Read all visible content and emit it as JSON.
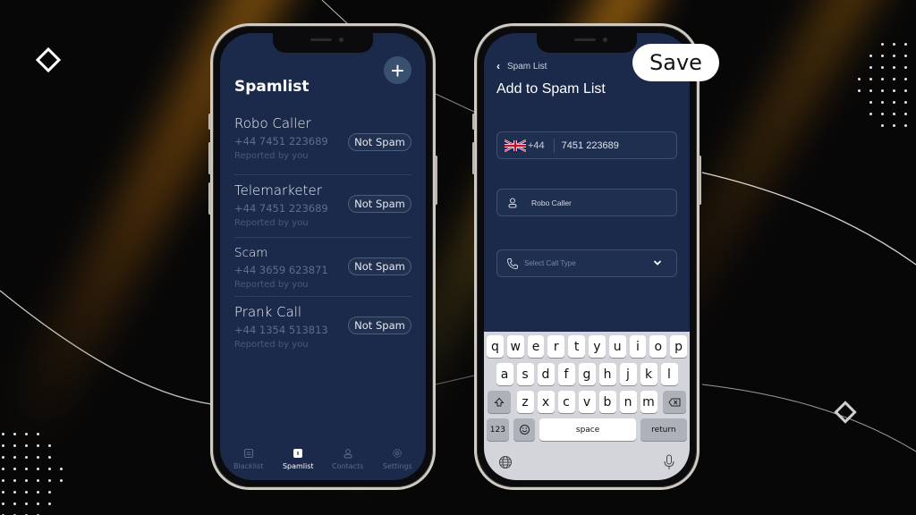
{
  "phone_left": {
    "title": "Spamlist",
    "add_button": "+",
    "items": [
      {
        "name": "Robo Caller",
        "number": "+44 7451 223689",
        "note": "Reported by you",
        "action": "Not Spam"
      },
      {
        "name": "Telemarketer",
        "number": "+44 7451 223689",
        "note": "Reported by you",
        "action": "Not Spam"
      },
      {
        "name": "Scam",
        "number": "+44 3659 623871",
        "note": "Reported by you",
        "action": "Not Spam"
      },
      {
        "name": "Prank Call",
        "number": "+44 1354 513813",
        "note": "Reported by you",
        "action": "Not Spam"
      }
    ],
    "tabs": [
      {
        "label": "Blacklist",
        "icon": "blacklist-icon",
        "active": false
      },
      {
        "label": "Spamlist",
        "icon": "spamlist-icon",
        "active": true
      },
      {
        "label": "Contacts",
        "icon": "contacts-icon",
        "active": false
      },
      {
        "label": "Settings",
        "icon": "settings-icon",
        "active": false
      }
    ]
  },
  "phone_right": {
    "back_label": "Spam List",
    "back_icon": "‹",
    "title": "Add to Spam List",
    "save_label": "Save",
    "phone_field": {
      "country_code": "+44",
      "value": "7451 223689",
      "flag": "uk-flag-icon"
    },
    "name_field": {
      "value": "Robo Caller",
      "icon": "person-icon"
    },
    "call_type_field": {
      "placeholder": "Select Call Type",
      "icon": "phone-icon"
    },
    "keyboard": {
      "row1": [
        "q",
        "w",
        "e",
        "r",
        "t",
        "y",
        "u",
        "i",
        "o",
        "p"
      ],
      "row2": [
        "a",
        "s",
        "d",
        "f",
        "g",
        "h",
        "j",
        "k",
        "l"
      ],
      "row3": [
        "z",
        "x",
        "c",
        "v",
        "b",
        "n",
        "m"
      ],
      "numbers_key": "123",
      "space_key": "space",
      "return_key": "return"
    }
  },
  "colors": {
    "screen_bg": "#1b2a4a",
    "accent_button": "#3a5070",
    "background": "#070708",
    "glow": "#c77c12"
  }
}
